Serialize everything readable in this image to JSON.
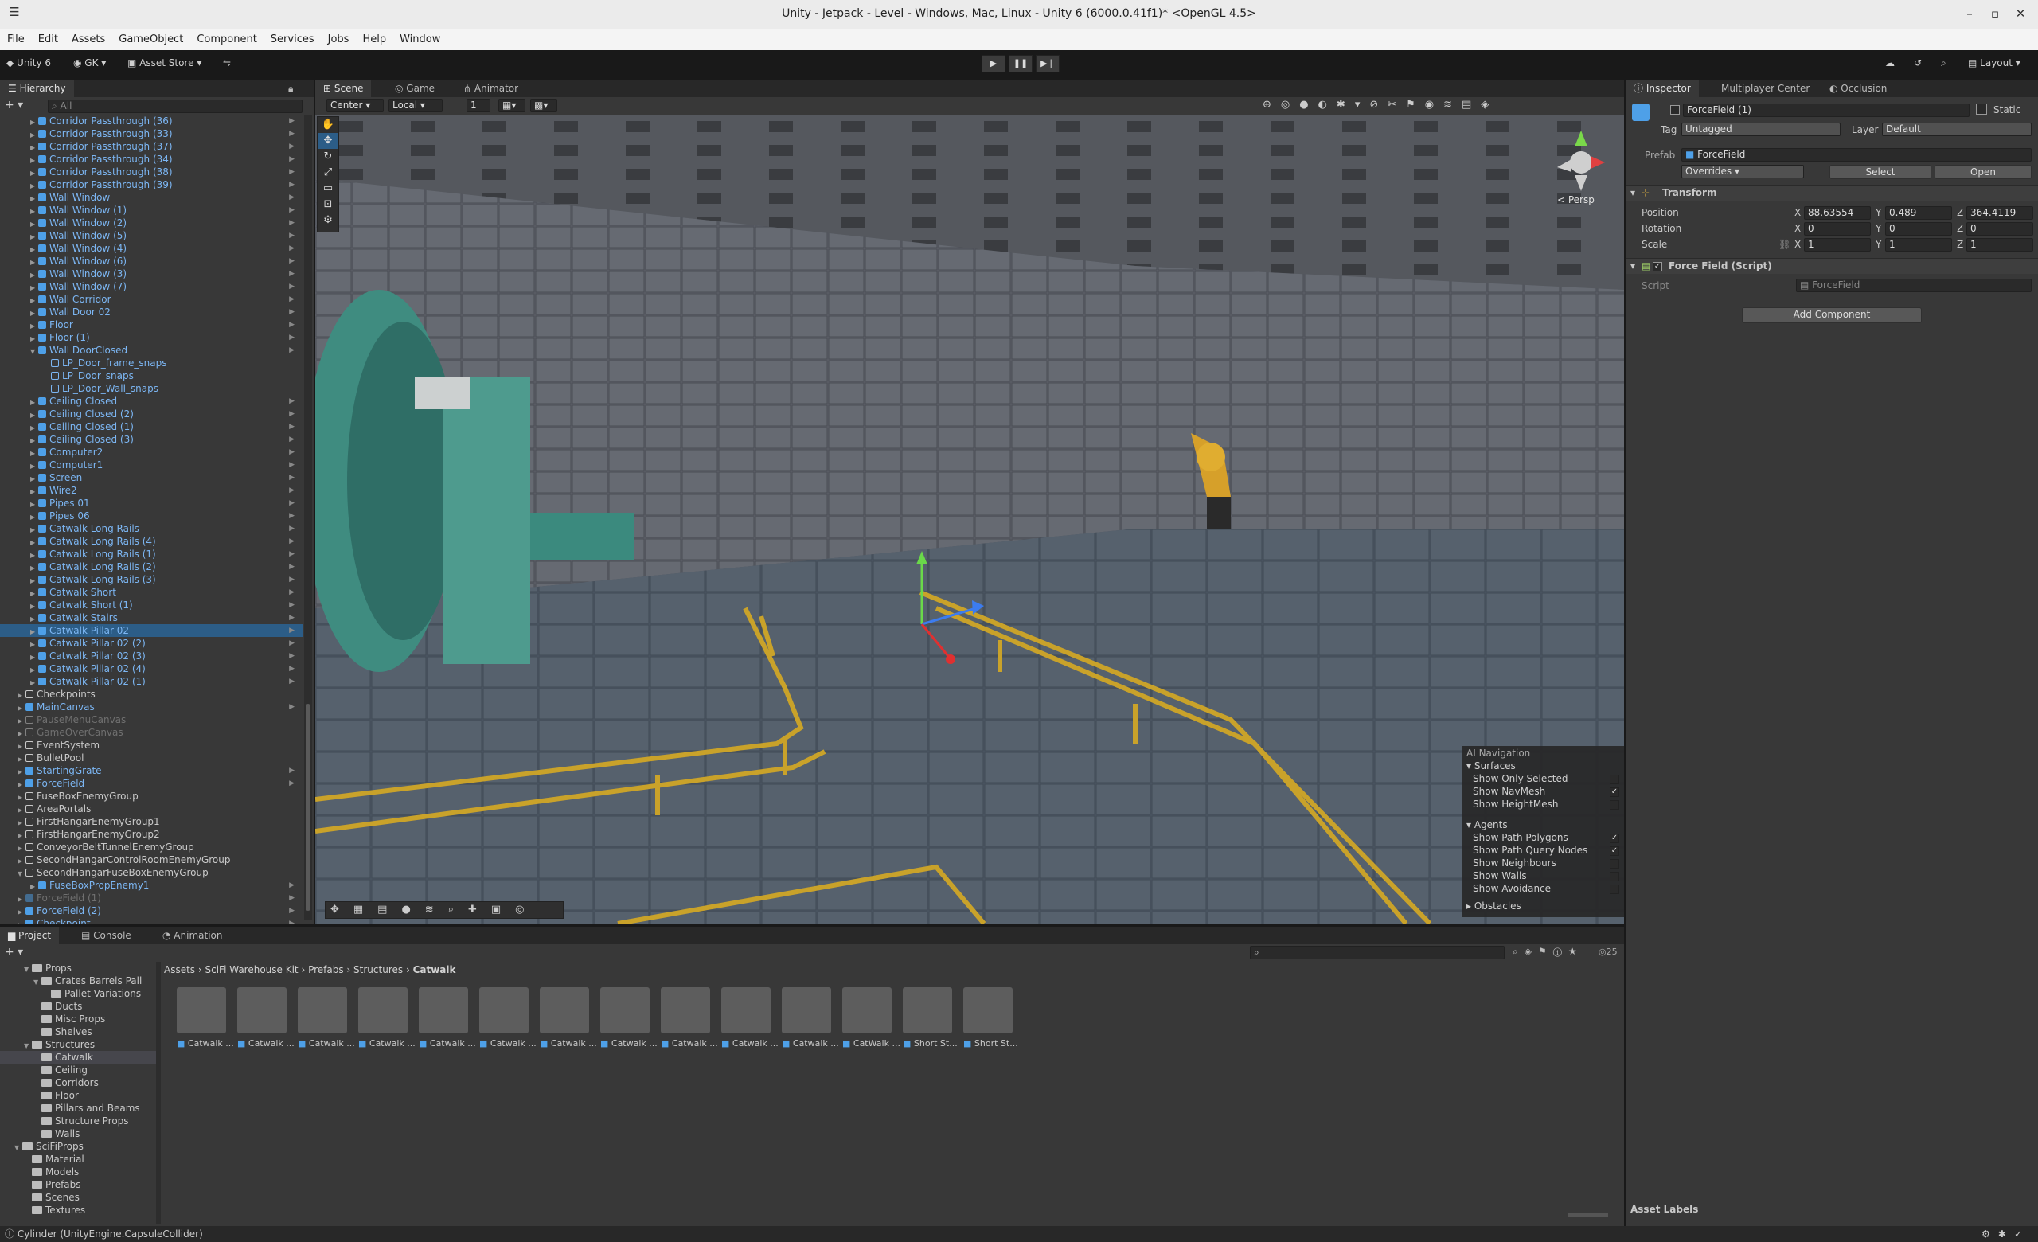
{
  "window": {
    "title": "Unity - Jetpack - Level - Windows, Mac, Linux - Unity 6 (6000.0.41f1)* <OpenGL 4.5>"
  },
  "menu": [
    "File",
    "Edit",
    "Assets",
    "GameObject",
    "Component",
    "Services",
    "Jobs",
    "Help",
    "Window"
  ],
  "toolbar": {
    "unity_label": "Unity 6",
    "account": "GK",
    "asset_store": "Asset Store",
    "layout": "Layout"
  },
  "hierarchy": {
    "tab": "Hierarchy",
    "search_placeholder": "All",
    "rows": [
      {
        "label": "Corridor Passthrough (36)",
        "indent": 3,
        "kind": "prefab",
        "arrow": true
      },
      {
        "label": "Corridor Passthrough (33)",
        "indent": 3,
        "kind": "prefab",
        "arrow": true
      },
      {
        "label": "Corridor Passthrough (37)",
        "indent": 3,
        "kind": "prefab",
        "arrow": true
      },
      {
        "label": "Corridor Passthrough (34)",
        "indent": 3,
        "kind": "prefab",
        "arrow": true
      },
      {
        "label": "Corridor Passthrough (38)",
        "indent": 3,
        "kind": "prefab",
        "arrow": true
      },
      {
        "label": "Corridor Passthrough (39)",
        "indent": 3,
        "kind": "prefab",
        "arrow": true
      },
      {
        "label": "Wall Window",
        "indent": 3,
        "kind": "prefab",
        "arrow": true
      },
      {
        "label": "Wall Window (1)",
        "indent": 3,
        "kind": "prefab",
        "arrow": true
      },
      {
        "label": "Wall Window (2)",
        "indent": 3,
        "kind": "prefab",
        "arrow": true
      },
      {
        "label": "Wall Window (5)",
        "indent": 3,
        "kind": "prefab",
        "arrow": true
      },
      {
        "label": "Wall Window (4)",
        "indent": 3,
        "kind": "prefab",
        "arrow": true
      },
      {
        "label": "Wall Window (6)",
        "indent": 3,
        "kind": "prefab",
        "arrow": true
      },
      {
        "label": "Wall Window (3)",
        "indent": 3,
        "kind": "prefab",
        "arrow": true
      },
      {
        "label": "Wall Window (7)",
        "indent": 3,
        "kind": "prefab",
        "arrow": true
      },
      {
        "label": "Wall Corridor",
        "indent": 3,
        "kind": "prefab",
        "arrow": true
      },
      {
        "label": "Wall Door 02",
        "indent": 3,
        "kind": "prefab",
        "arrow": true
      },
      {
        "label": "Floor",
        "indent": 3,
        "kind": "prefab",
        "arrow": true
      },
      {
        "label": "Floor (1)",
        "indent": 3,
        "kind": "prefab",
        "arrow": true
      },
      {
        "label": "Wall DoorClosed",
        "indent": 3,
        "kind": "prefab",
        "arrow": true,
        "open": true
      },
      {
        "label": "LP_Door_frame_snaps",
        "indent": 4,
        "kind": "child",
        "arrow": false
      },
      {
        "label": "LP_Door_snaps",
        "indent": 4,
        "kind": "child",
        "arrow": false
      },
      {
        "label": "LP_Door_Wall_snaps",
        "indent": 4,
        "kind": "child",
        "arrow": false
      },
      {
        "label": "Ceiling Closed",
        "indent": 3,
        "kind": "prefab",
        "arrow": true
      },
      {
        "label": "Ceiling Closed (2)",
        "indent": 3,
        "kind": "prefab",
        "arrow": true
      },
      {
        "label": "Ceiling Closed (1)",
        "indent": 3,
        "kind": "prefab",
        "arrow": true
      },
      {
        "label": "Ceiling Closed (3)",
        "indent": 3,
        "kind": "prefab",
        "arrow": true
      },
      {
        "label": "Computer2",
        "indent": 3,
        "kind": "prefab",
        "arrow": true
      },
      {
        "label": "Computer1",
        "indent": 3,
        "kind": "prefab",
        "arrow": true
      },
      {
        "label": "Screen",
        "indent": 3,
        "kind": "prefab",
        "arrow": true
      },
      {
        "label": "Wire2",
        "indent": 3,
        "kind": "prefab",
        "arrow": true
      },
      {
        "label": "Pipes 01",
        "indent": 3,
        "kind": "prefab",
        "arrow": true
      },
      {
        "label": "Pipes 06",
        "indent": 3,
        "kind": "prefab",
        "arrow": true
      },
      {
        "label": "Catwalk Long Rails",
        "indent": 3,
        "kind": "prefab",
        "arrow": true
      },
      {
        "label": "Catwalk Long Rails (4)",
        "indent": 3,
        "kind": "prefab",
        "arrow": true
      },
      {
        "label": "Catwalk Long Rails (1)",
        "indent": 3,
        "kind": "prefab",
        "arrow": true
      },
      {
        "label": "Catwalk Long Rails (2)",
        "indent": 3,
        "kind": "prefab",
        "arrow": true
      },
      {
        "label": "Catwalk Long Rails (3)",
        "indent": 3,
        "kind": "prefab",
        "arrow": true
      },
      {
        "label": "Catwalk Short",
        "indent": 3,
        "kind": "prefab",
        "arrow": true
      },
      {
        "label": "Catwalk Short (1)",
        "indent": 3,
        "kind": "prefab",
        "arrow": true
      },
      {
        "label": "Catwalk Stairs",
        "indent": 3,
        "kind": "prefab",
        "arrow": true
      },
      {
        "label": "Catwalk Pillar 02",
        "indent": 3,
        "kind": "prefab",
        "arrow": true,
        "selected": true
      },
      {
        "label": "Catwalk Pillar 02 (2)",
        "indent": 3,
        "kind": "prefab",
        "arrow": true
      },
      {
        "label": "Catwalk Pillar 02 (3)",
        "indent": 3,
        "kind": "prefab",
        "arrow": true
      },
      {
        "label": "Catwalk Pillar 02 (4)",
        "indent": 3,
        "kind": "prefab",
        "arrow": true
      },
      {
        "label": "Catwalk Pillar 02 (1)",
        "indent": 3,
        "kind": "prefab",
        "arrow": true
      },
      {
        "label": "Checkpoints",
        "indent": 2,
        "kind": "object",
        "arrow": true
      },
      {
        "label": "MainCanvas",
        "indent": 2,
        "kind": "prefab",
        "arrow": true
      },
      {
        "label": "PauseMenuCanvas",
        "indent": 2,
        "kind": "dim",
        "arrow": true
      },
      {
        "label": "GameOverCanvas",
        "indent": 2,
        "kind": "dim",
        "arrow": true
      },
      {
        "label": "EventSystem",
        "indent": 2,
        "kind": "object",
        "arrow": false
      },
      {
        "label": "BulletPool",
        "indent": 2,
        "kind": "object",
        "arrow": false
      },
      {
        "label": "StartingGrate",
        "indent": 2,
        "kind": "prefab",
        "arrow": true
      },
      {
        "label": "ForceField",
        "indent": 2,
        "kind": "prefab",
        "arrow": true
      },
      {
        "label": "FuseBoxEnemyGroup",
        "indent": 2,
        "kind": "object",
        "arrow": false
      },
      {
        "label": "AreaPortals",
        "indent": 2,
        "kind": "object",
        "arrow": false
      },
      {
        "label": "FirstHangarEnemyGroup1",
        "indent": 2,
        "kind": "object",
        "arrow": false
      },
      {
        "label": "FirstHangarEnemyGroup2",
        "indent": 2,
        "kind": "object",
        "arrow": false
      },
      {
        "label": "ConveyorBeltTunnelEnemyGroup",
        "indent": 2,
        "kind": "object",
        "arrow": false
      },
      {
        "label": "SecondHangarControlRoomEnemyGroup",
        "indent": 2,
        "kind": "object",
        "arrow": false
      },
      {
        "label": "SecondHangarFuseBoxEnemyGroup",
        "indent": 2,
        "kind": "object",
        "arrow": false,
        "open": true
      },
      {
        "label": "FuseBoxPropEnemy1",
        "indent": 3,
        "kind": "prefab",
        "arrow": true
      },
      {
        "label": "ForceField (1)",
        "indent": 2,
        "kind": "dimprefab",
        "arrow": true
      },
      {
        "label": "ForceField (2)",
        "indent": 2,
        "kind": "prefab",
        "arrow": true
      },
      {
        "label": "Checkpoint",
        "indent": 2,
        "kind": "prefab",
        "arrow": true
      }
    ]
  },
  "scene": {
    "tabs": [
      "Scene",
      "Game",
      "Animator"
    ],
    "pivot": "Center",
    "space": "Local",
    "snap": "1",
    "persp_label": "< Persp"
  },
  "ai_nav": {
    "title": "AI Navigation",
    "surfaces_header": "Surfaces",
    "surfaces": [
      {
        "label": "Show Only Selected",
        "checked": false
      },
      {
        "label": "Show NavMesh",
        "checked": true
      },
      {
        "label": "Show HeightMesh",
        "checked": false
      }
    ],
    "agents_header": "Agents",
    "agents": [
      {
        "label": "Show Path Polygons",
        "checked": true
      },
      {
        "label": "Show Path Query Nodes",
        "checked": true
      },
      {
        "label": "Show Neighbours",
        "checked": false
      },
      {
        "label": "Show Walls",
        "checked": false
      },
      {
        "label": "Show Avoidance",
        "checked": false
      }
    ],
    "obstacles_header": "Obstacles"
  },
  "inspector": {
    "tabs": [
      "Inspector",
      "Multiplayer Center",
      "Occlusion"
    ],
    "object_name": "ForceField (1)",
    "static_label": "Static",
    "tag_label": "Tag",
    "tag_value": "Untagged",
    "layer_label": "Layer",
    "layer_value": "Default",
    "prefab_label": "Prefab",
    "prefab_value": "ForceField",
    "overrides": "Overrides",
    "select_btn": "Select",
    "open_btn": "Open",
    "transform_title": "Transform",
    "position_label": "Position",
    "rotation_label": "Rotation",
    "scale_label": "Scale",
    "position": {
      "x": "88.63554",
      "y": "0.489",
      "z": "364.4119"
    },
    "rotation": {
      "x": "0",
      "y": "0",
      "z": "0"
    },
    "scale": {
      "x": "1",
      "y": "1",
      "z": "1"
    },
    "script_component": "Force Field (Script)",
    "script_label": "Script",
    "script_value": "ForceField",
    "add_component": "Add Component",
    "asset_labels": "Asset Labels"
  },
  "project": {
    "tabs": [
      "Project",
      "Console",
      "Animation"
    ],
    "breadcrumb": [
      "Assets",
      "SciFi Warehouse Kit",
      "Prefabs",
      "Structures",
      "Catwalk"
    ],
    "item_count": "25",
    "tree": [
      {
        "label": "Props",
        "indent": 2,
        "open": true
      },
      {
        "label": "Crates Barrels Pall",
        "indent": 3,
        "open": true
      },
      {
        "label": "Pallet Variations",
        "indent": 4
      },
      {
        "label": "Ducts",
        "indent": 3
      },
      {
        "label": "Misc Props",
        "indent": 3
      },
      {
        "label": "Shelves",
        "indent": 3
      },
      {
        "label": "Structures",
        "indent": 2,
        "open": true
      },
      {
        "label": "Catwalk",
        "indent": 3,
        "selected": true
      },
      {
        "label": "Ceiling",
        "indent": 3
      },
      {
        "label": "Corridors",
        "indent": 3
      },
      {
        "label": "Floor",
        "indent": 3
      },
      {
        "label": "Pillars and Beams",
        "indent": 3
      },
      {
        "label": "Structure Props",
        "indent": 3
      },
      {
        "label": "Walls",
        "indent": 3
      },
      {
        "label": "SciFiProps",
        "indent": 1,
        "open": true
      },
      {
        "label": "Material",
        "indent": 2
      },
      {
        "label": "Models",
        "indent": 2
      },
      {
        "label": "Prefabs",
        "indent": 2
      },
      {
        "label": "Scenes",
        "indent": 2
      },
      {
        "label": "Textures",
        "indent": 2
      }
    ],
    "assets": [
      "Catwalk ...",
      "Catwalk ...",
      "Catwalk ...",
      "Catwalk ...",
      "Catwalk ...",
      "Catwalk ...",
      "Catwalk ...",
      "Catwalk ...",
      "Catwalk ...",
      "Catwalk ...",
      "Catwalk ...",
      "CatWalk ...",
      "Short St...",
      "Short St..."
    ]
  },
  "status": {
    "message": "Cylinder (UnityEngine.CapsuleCollider)"
  }
}
